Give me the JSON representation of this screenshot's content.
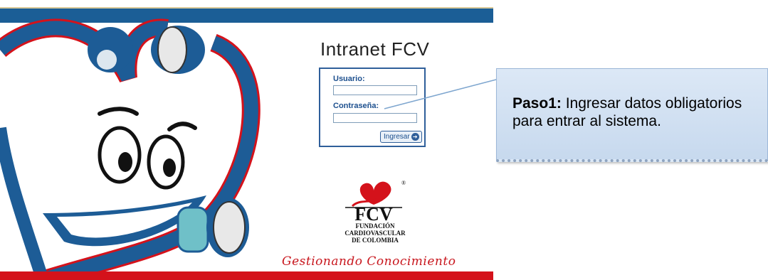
{
  "login": {
    "title": "Intranet FCV",
    "username_label": "Usuario:",
    "username_value": "",
    "password_label": "Contraseña:",
    "password_value": "",
    "submit_label": "Ingresar",
    "submit_icon": "arrow-right-icon"
  },
  "branding": {
    "logo_text": "FCV",
    "registered_mark": "®",
    "foundation_name": "FUNDACIÓN\nCARDIOVASCULAR\nDE COLOMBIA",
    "slogan": "Gestionando Conocimiento",
    "brand_red": "#d4121b",
    "brand_blue": "#1b5e96"
  },
  "callout": {
    "step_label": "Paso1:",
    "text": " Ingresar datos obligatorios para entrar al sistema."
  }
}
